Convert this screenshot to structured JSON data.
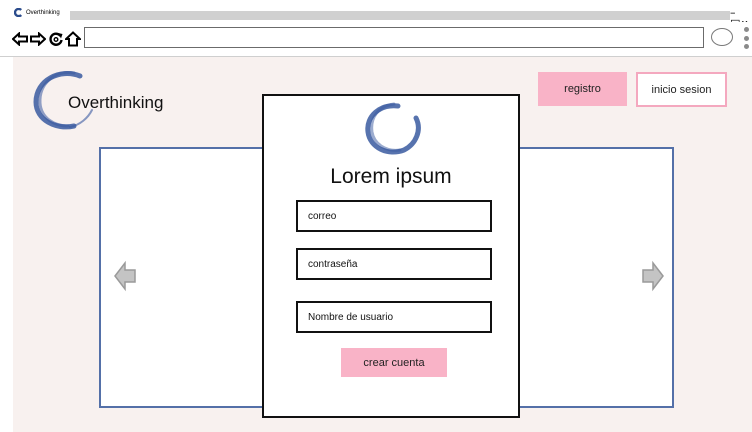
{
  "browser": {
    "tab_title": "Overthinking",
    "window_controls": "–□x",
    "address_value": ""
  },
  "site": {
    "name": "Overthinking"
  },
  "header": {
    "register_label": "registro",
    "login_label": "inicio sesion"
  },
  "modal": {
    "title": "Lorem ipsum",
    "fields": [
      {
        "label": "correo"
      },
      {
        "label": "contraseña"
      },
      {
        "label": "Nombre de usuario"
      }
    ],
    "submit_label": "crear cuenta"
  },
  "colors": {
    "accent_pink": "#f9b3c7",
    "carousel_border": "#5470a8",
    "page_background": "#f8f1ef"
  },
  "icons": [
    "logo-icon",
    "back-icon",
    "forward-icon",
    "reload-icon",
    "home-icon",
    "circle-icon",
    "kebab-icon",
    "arrow-left-icon",
    "arrow-right-icon"
  ]
}
